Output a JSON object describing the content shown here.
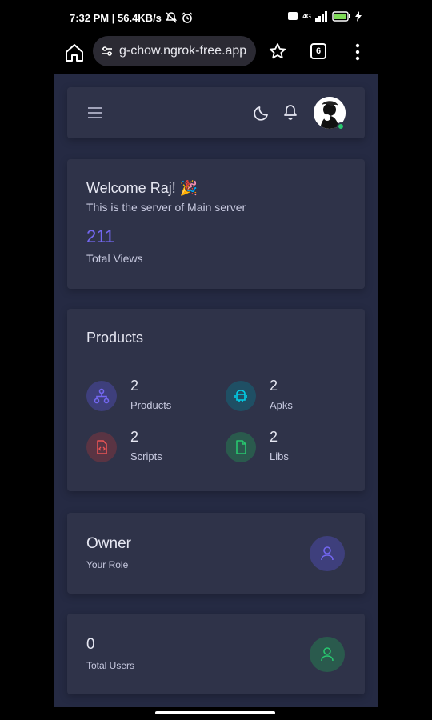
{
  "status_bar": {
    "time_speed": "7:32 PM | 56.4KB/s",
    "signal": "4G",
    "battery": "84"
  },
  "browser": {
    "url": "g-chow.ngrok-free.app",
    "tab_count": "6"
  },
  "welcome": {
    "title": "Welcome Raj! 🎉",
    "subtitle": "This is the server of Main server",
    "views_value": "211",
    "views_label": "Total Views"
  },
  "products": {
    "title": "Products",
    "items": [
      {
        "value": "2",
        "label": "Products",
        "icon": "sitemap-icon"
      },
      {
        "value": "2",
        "label": "Apks",
        "icon": "android-icon"
      },
      {
        "value": "2",
        "label": "Scripts",
        "icon": "script-file-icon"
      },
      {
        "value": "2",
        "label": "Libs",
        "icon": "file-icon"
      }
    ]
  },
  "owner": {
    "role": "Owner",
    "label": "Your Role"
  },
  "users": {
    "value": "0",
    "label": "Total Users"
  },
  "colors": {
    "accent": "#7367f0",
    "card": "#2f3349",
    "page": "#252a43",
    "success": "#28c76f",
    "info": "#00cfe8",
    "danger": "#ea5455"
  }
}
